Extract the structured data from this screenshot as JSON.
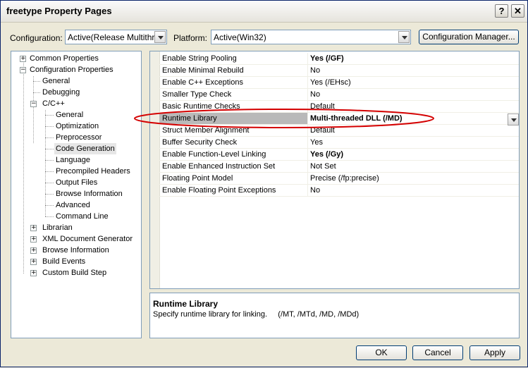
{
  "window": {
    "title": "freetype Property Pages"
  },
  "title_buttons": {
    "help": "?",
    "close": "✕"
  },
  "toolbar": {
    "configuration_label": "Configuration:",
    "configuration_value": "Active(Release Multithrea",
    "platform_label": "Platform:",
    "platform_value": "Active(Win32)",
    "config_manager_label": "Configuration Manager..."
  },
  "tree": {
    "common_properties": "Common Properties",
    "configuration_properties": "Configuration Properties",
    "general": "General",
    "debugging": "Debugging",
    "cpp": "C/C++",
    "cpp_general": "General",
    "optimization": "Optimization",
    "preprocessor": "Preprocessor",
    "code_generation": "Code Generation",
    "language": "Language",
    "precompiled_headers": "Precompiled Headers",
    "output_files": "Output Files",
    "browse_information_cpp": "Browse Information",
    "advanced": "Advanced",
    "command_line": "Command Line",
    "librarian": "Librarian",
    "xml_document_generator": "XML Document Generator",
    "browse_information": "Browse Information",
    "build_events": "Build Events",
    "custom_build_step": "Custom Build Step",
    "expand_symbol": "+",
    "collapse_symbol": "−"
  },
  "properties": [
    {
      "name": "Enable String Pooling",
      "value": "Yes (/GF)",
      "bold": true
    },
    {
      "name": "Enable Minimal Rebuild",
      "value": "No",
      "bold": false
    },
    {
      "name": "Enable C++ Exceptions",
      "value": "Yes (/EHsc)",
      "bold": false
    },
    {
      "name": "Smaller Type Check",
      "value": "No",
      "bold": false
    },
    {
      "name": "Basic Runtime Checks",
      "value": "Default",
      "bold": false
    },
    {
      "name": "Runtime Library",
      "value": "Multi-threaded DLL (/MD)",
      "bold": true
    },
    {
      "name": "Struct Member Alignment",
      "value": "Default",
      "bold": false
    },
    {
      "name": "Buffer Security Check",
      "value": "Yes",
      "bold": false
    },
    {
      "name": "Enable Function-Level Linking",
      "value": "Yes (/Gy)",
      "bold": true
    },
    {
      "name": "Enable Enhanced Instruction Set",
      "value": "Not Set",
      "bold": false
    },
    {
      "name": "Floating Point Model",
      "value": "Precise (/fp:precise)",
      "bold": false
    },
    {
      "name": "Enable Floating Point Exceptions",
      "value": "No",
      "bold": false
    }
  ],
  "description": {
    "title": "Runtime Library",
    "text": "Specify runtime library for linking.     (/MT, /MTd, /MD, /MDd)"
  },
  "buttons": {
    "ok": "OK",
    "cancel": "Cancel",
    "apply": "Apply"
  },
  "colors": {
    "highlight_ellipse": "#d40000",
    "selected_row": "#b9b9b9"
  }
}
